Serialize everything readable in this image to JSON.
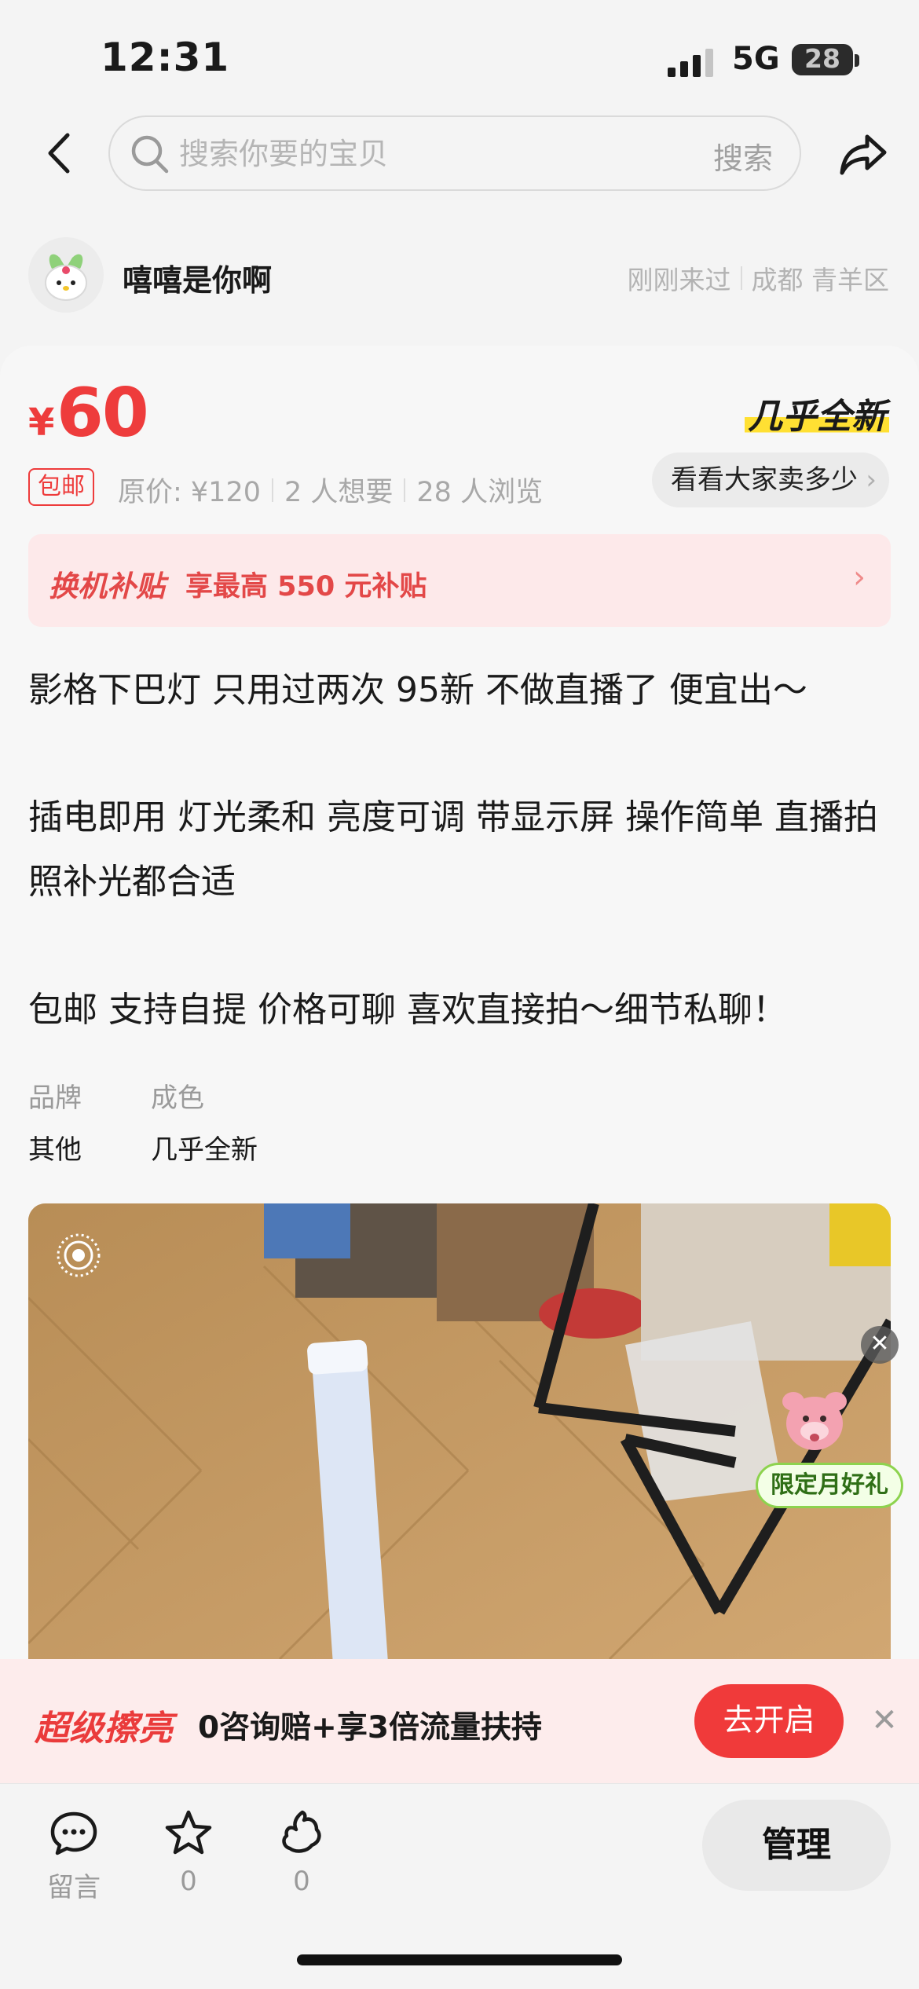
{
  "status_bar": {
    "time": "12:31",
    "network": "5G",
    "battery": "28"
  },
  "nav": {
    "search_placeholder": "搜索你要的宝贝",
    "search_button": "搜索"
  },
  "seller": {
    "name": "嘻嘻是你啊",
    "last_seen": "刚刚来过",
    "location": "成都 青羊区"
  },
  "listing": {
    "price_symbol": "¥",
    "price": "60",
    "condition_tag": "几乎全新",
    "shipping_badge": "包邮",
    "original_price": "原价: ¥120",
    "wants": "2 人想要",
    "views": "28 人浏览",
    "compare_button": "看看大家卖多少",
    "subsidy": {
      "label": "换机补贴",
      "text": "享最高 550 元补贴"
    },
    "description": [
      "影格下巴灯 只用过两次 95新 不做直播了 便宜出～",
      "插电即用 灯光柔和 亮度可调 带显示屏 操作简单 直播拍照补光都合适",
      "包邮 支持自提 价格可聊 喜欢直接拍～细节私聊！"
    ],
    "attributes": [
      {
        "label": "品牌",
        "value": "其他"
      },
      {
        "label": "成色",
        "value": "几乎全新"
      }
    ]
  },
  "gift_badge": "限定月好礼",
  "promo": {
    "title": "超级擦亮",
    "text": "0咨询赔+享3倍流量扶持",
    "button": "去开启"
  },
  "bottom_bar": {
    "actions": [
      {
        "label": "留言",
        "icon": "comment-icon"
      },
      {
        "label": "0",
        "icon": "star-icon"
      },
      {
        "label": "0",
        "icon": "like-icon"
      }
    ],
    "manage_button": "管理"
  },
  "colors": {
    "accent": "#ee3c3c",
    "highlight": "#ffe033"
  }
}
